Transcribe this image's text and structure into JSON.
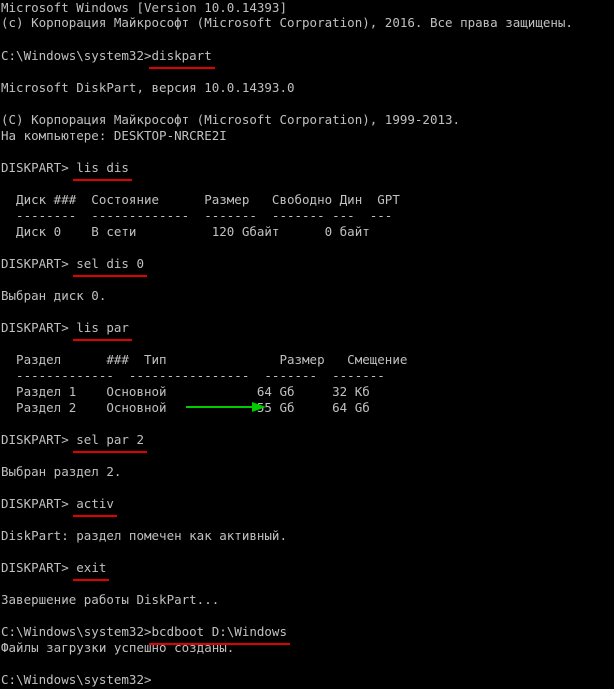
{
  "window": {
    "background": "#000000",
    "text_color": "#c0c0c0",
    "underline_color": "#e00000",
    "arrow_color": "#00cc00"
  },
  "header": {
    "version_line": "Microsoft Windows [Version 10.0.14393]",
    "copyright_line": "(c) Корпорация Майкрософт (Microsoft Corporation), 2016. Все права защищены."
  },
  "session": {
    "prompt1": "C:\\Windows\\system32>",
    "cmd1": "diskpart",
    "dp_version": "Microsoft DiskPart, версия 10.0.14393.0",
    "dp_copyright": "(C) Корпорация Майкрософт (Microsoft Corporation), 1999-2013.",
    "computer": "На компьютере: DESKTOP-NRCRE2I",
    "dp_prompt": "DISKPART> ",
    "cmd_lis_dis": "lis dis",
    "disk_table": {
      "header": "  Диск ###  Состояние      Размер   Свободно Дин  GPT",
      "separator": "  --------  -------------  -------  ------- ---  ---",
      "rows": [
        "  Диск 0    В сети          120 Gбайт      0 байт"
      ]
    },
    "cmd_sel_dis": "sel dis 0",
    "sel_dis_result": "Выбран диск 0.",
    "cmd_lis_par": "lis par",
    "partition_table": {
      "header": "  Раздел      ###  Тип               Размер   Смещение",
      "separator": "  -------------  ----------------  -------  -------",
      "rows": [
        "  Раздел 1    Основной            64 Gб     32 Kб",
        "  Раздел 2    Основной            55 Gб     64 Gб"
      ]
    },
    "cmd_sel_par": "sel par 2",
    "sel_par_result": "Выбран раздел 2.",
    "cmd_activ": "activ",
    "activ_result": "DiskPart: раздел помечен как активный.",
    "cmd_exit": "exit",
    "exit_result": "Завершение работы DiskPart...",
    "prompt2": "C:\\Windows\\system32>",
    "cmd_bcdboot": "bcdboot D:\\Windows",
    "bcdboot_result": "Файлы загрузки успешно созданы.",
    "prompt3": "C:\\Windows\\system32>"
  }
}
